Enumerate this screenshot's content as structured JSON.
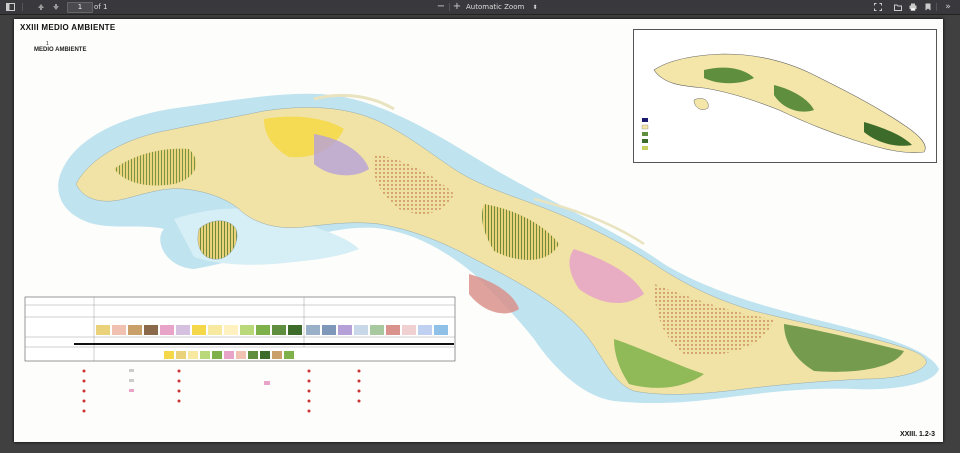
{
  "toolbar": {
    "page_number": "1",
    "page_count_text": "of 1",
    "zoom_label": "Automatic Zoom"
  },
  "document": {
    "sheet_title": "XXIII MEDIO AMBIENTE",
    "map_title_number": "1",
    "map_title": "MEDIO AMBIENTE",
    "page_label": "XXIII. 1.2-3"
  }
}
